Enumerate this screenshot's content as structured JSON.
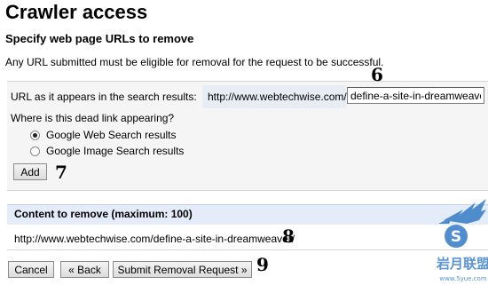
{
  "page": {
    "title": "Crawler access",
    "subtitle": "Specify web page URLs to remove",
    "intro": "Any URL submitted must be eligible for removal for the request to be successful."
  },
  "form": {
    "url_label": "URL as it appears in the search results:",
    "url_prefix": "http://www.webtechwise.com/",
    "url_value": "define-a-site-in-dreamweaver/",
    "where_label": "Where is this dead link appearing?",
    "options": [
      {
        "label": "Google Web Search results",
        "checked": true
      },
      {
        "label": "Google Image Search results",
        "checked": false
      }
    ],
    "add_label": "Add"
  },
  "content": {
    "title": "Content to remove (maximum: 100)",
    "items": [
      "http://www.webtechwise.com/define-a-site-in-dreamweaver/"
    ]
  },
  "actions": {
    "cancel": "Cancel",
    "back": "« Back",
    "submit": "Submit Removal Request »"
  },
  "annotations": {
    "n6": "6",
    "n7": "7",
    "n8": "8",
    "n9": "9"
  },
  "watermark": {
    "text": "岩月联盟",
    "sub": "www.5yue.com",
    "icon": "winged-s-logo",
    "color": "#3f82c8"
  },
  "colors": {
    "header_bg": "#e5ecf9",
    "form_bg": "#f5f5f5",
    "prefix_bg": "#e8edf5"
  }
}
